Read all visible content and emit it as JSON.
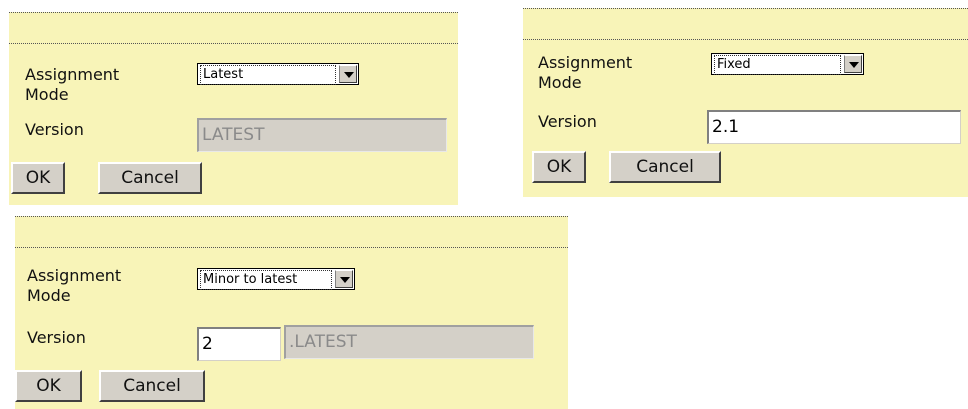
{
  "panels": [
    {
      "assignment_label_line1": "Assignment",
      "assignment_label_line2": "Mode",
      "mode_value": "Latest",
      "version_label": "Version",
      "version_value": "LATEST",
      "ok_label": "OK",
      "cancel_label": "Cancel"
    },
    {
      "assignment_label_line1": "Assignment",
      "assignment_label_line2": "Mode",
      "mode_value": "Fixed",
      "version_label": "Version",
      "version_value": "2.1",
      "ok_label": "OK",
      "cancel_label": "Cancel"
    },
    {
      "assignment_label_line1": "Assignment",
      "assignment_label_line2": "Mode",
      "mode_value": "Minor to latest",
      "version_label": "Version",
      "version_major_value": "2",
      "version_suffix_value": ".LATEST",
      "ok_label": "OK",
      "cancel_label": "Cancel"
    }
  ]
}
